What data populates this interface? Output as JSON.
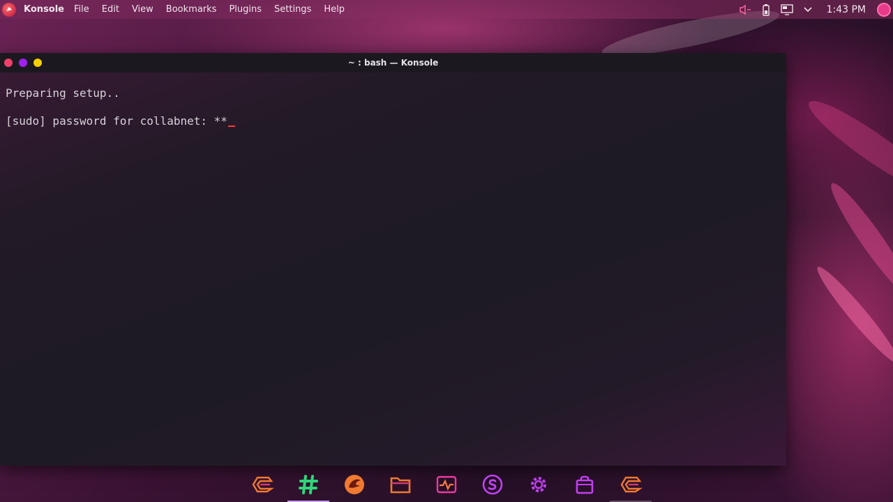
{
  "menubar": {
    "app_name": "Konsole",
    "items": [
      {
        "label": "File"
      },
      {
        "label": "Edit"
      },
      {
        "label": "View"
      },
      {
        "label": "Bookmarks"
      },
      {
        "label": "Plugins"
      },
      {
        "label": "Settings"
      },
      {
        "label": "Help"
      }
    ]
  },
  "tray": {
    "icons": [
      "volume-muted-icon",
      "battery-icon",
      "display-icon",
      "chevron-down-icon"
    ],
    "clock": "1:43 PM"
  },
  "window": {
    "title": "~ : bash — Konsole",
    "buttons": [
      "close",
      "minimize",
      "maximize"
    ],
    "colors": {
      "close": "#f0406a",
      "minimize": "#a020f0",
      "maximize": "#f5d000"
    }
  },
  "terminal": {
    "lines": [
      "Preparing setup..",
      "[sudo] password for collabnet: **"
    ],
    "cursor_color": "#ff3a3a"
  },
  "dock": {
    "items": [
      {
        "icon": "garuda-logo-icon",
        "color": "#f07a30"
      },
      {
        "icon": "hashtag-icon",
        "color": "#2fd67a",
        "active": true
      },
      {
        "icon": "garuda-eagle-icon",
        "color": "#f07a30"
      },
      {
        "icon": "folder-icon",
        "color": "#f07a30"
      },
      {
        "icon": "system-monitor-icon",
        "color": "#ec3aa0"
      },
      {
        "icon": "s-app-icon",
        "color": "#c040f0"
      },
      {
        "icon": "settings-gear-icon",
        "color": "#c040f0"
      },
      {
        "icon": "store-bag-icon",
        "color": "#c040f0"
      },
      {
        "icon": "garuda-logo-icon",
        "color": "#f07a30",
        "dim_indicator": true
      }
    ]
  }
}
